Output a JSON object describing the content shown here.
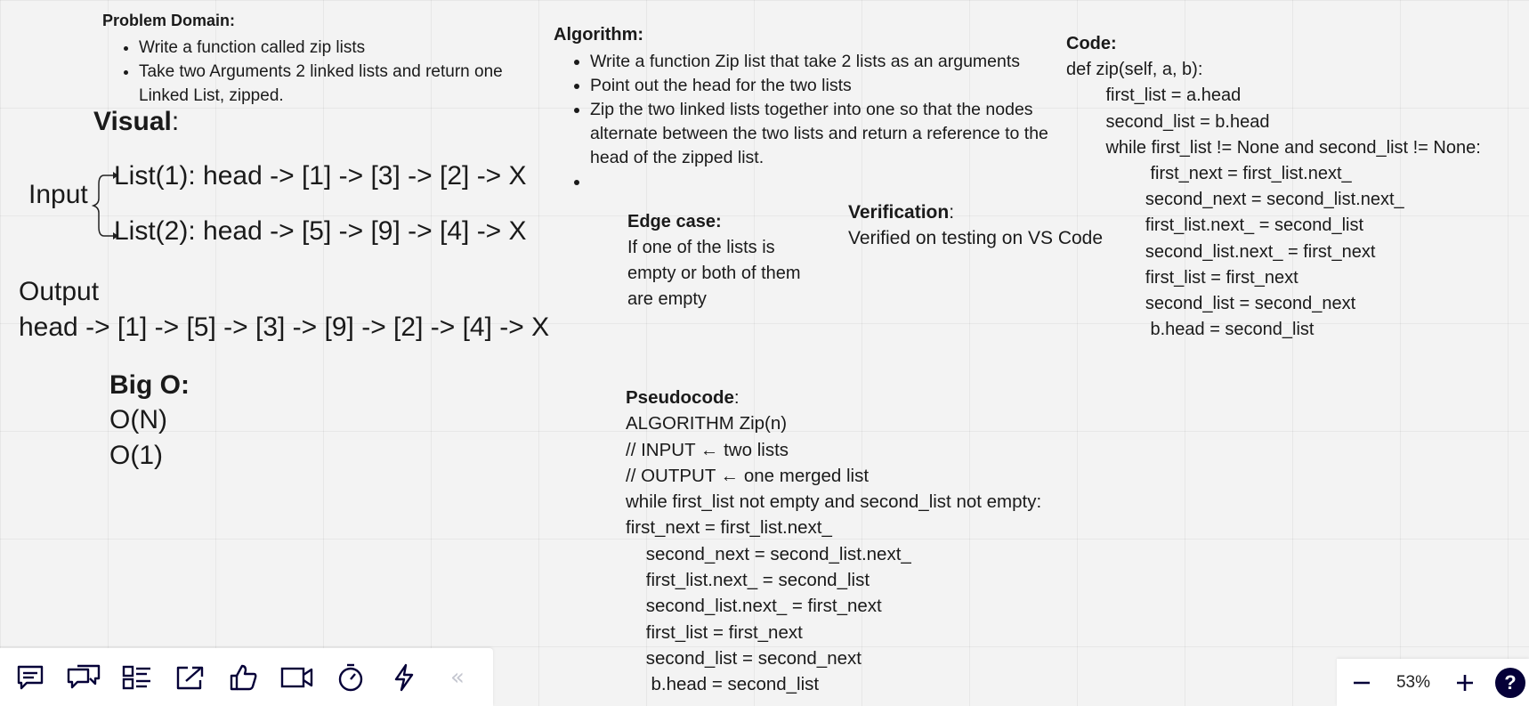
{
  "problem_domain": {
    "heading": "Problem Domain:",
    "bullets": [
      "Write a function called zip lists",
      "Take two Arguments 2 linked lists and return one Linked List, zipped."
    ]
  },
  "visual": {
    "heading": "Visual",
    "colon": ":",
    "input_label": "Input",
    "list1": "List(1): head -> [1] -> [3] -> [2] -> X",
    "list2": "List(2): head -> [5] -> [9] -> [4] -> X",
    "output_label": "Output",
    "output_value": "head -> [1] -> [5] -> [3] -> [9] -> [2] -> [4] -> X"
  },
  "big_o": {
    "heading": "Big O:",
    "time": "O(N)",
    "space": "O(1)"
  },
  "algorithm": {
    "heading": "Algorithm:",
    "bullets": [
      "Write a function Zip list that take 2 lists as an arguments",
      "Point out the head for the two lists",
      "Zip the two linked lists together into one so that the nodes alternate between the two lists and return a reference to the head of the zipped list.",
      ""
    ]
  },
  "edge_case": {
    "heading": "Edge case:",
    "text": "If one of the lists is empty or both of them are empty"
  },
  "verification": {
    "heading": "Verification",
    "colon": ":",
    "text": "Verified on testing on VS Code"
  },
  "code": {
    "heading": "Code:",
    "body": "def zip(self, a, b):\n        first_list = a.head\n        second_list = b.head\n        while first_list != None and second_list != None:\n                 first_next = first_list.next_\n                second_next = second_list.next_\n                first_list.next_ = second_list\n                second_list.next_ = first_next\n                first_list = first_next\n                second_list = second_next\n                 b.head = second_list"
  },
  "pseudocode": {
    "heading": "Pseudocode",
    "colon": ":",
    "body": "ALGORITHM Zip(n)\n// INPUT ← two lists\n// OUTPUT ← one merged list\nwhile first_list not empty and second_list not empty:\nfirst_next = first_list.next_\n    second_next = second_list.next_\n    first_list.next_ = second_list\n    second_list.next_ = first_next\n    first_list = first_next\n    second_list = second_next\n     b.head = second_list"
  },
  "toolbar": {
    "icons": [
      "comment-icon",
      "chat-icon",
      "card-list-icon",
      "share-screen-icon",
      "thumbs-up-icon",
      "video-icon",
      "timer-icon",
      "lightning-icon"
    ],
    "collapse_glyph": "«"
  },
  "zoom": {
    "level": "53%",
    "minus": "−",
    "plus": "+",
    "help": "?"
  },
  "colors": {
    "canvas": "#f3f3f3",
    "text": "#1a1a1a",
    "toolbar_icon": "#050038",
    "help_bg": "#050038"
  }
}
